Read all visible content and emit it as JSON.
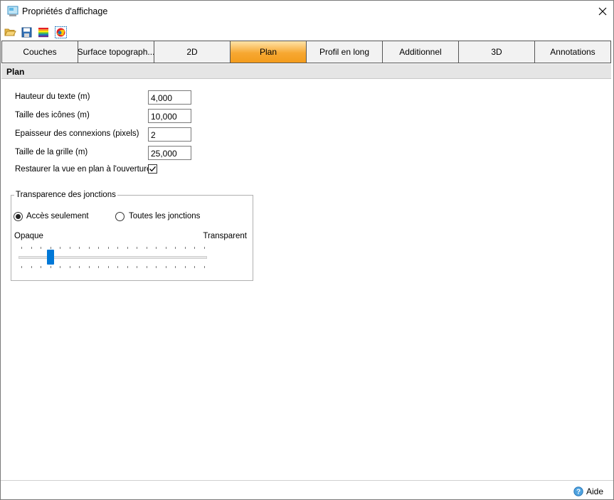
{
  "window": {
    "title": "Propriétés d'affichage"
  },
  "toolbar": {
    "icons": [
      "open-folder-icon",
      "save-icon",
      "rainbow-palette-icon",
      "color-picker-icon"
    ]
  },
  "tabs": [
    {
      "label": "Couches",
      "active": false
    },
    {
      "label": "Surface topograph...",
      "active": false
    },
    {
      "label": "2D",
      "active": false
    },
    {
      "label": "Plan",
      "active": true
    },
    {
      "label": "Profil en long",
      "active": false
    },
    {
      "label": "Additionnel",
      "active": false
    },
    {
      "label": "3D",
      "active": false
    },
    {
      "label": "Annotations",
      "active": false
    }
  ],
  "section": {
    "title": "Plan"
  },
  "fields": [
    {
      "label": "Hauteur du texte (m)",
      "value": "4,000"
    },
    {
      "label": "Taille des icônes (m)",
      "value": "10,000"
    },
    {
      "label": "Epaisseur des connexions (pixels)",
      "value": "2"
    },
    {
      "label": "Taille de la grille (m)",
      "value": "25,000"
    }
  ],
  "restore_view": {
    "label": "Restaurer la vue en plan à l'ouverture",
    "checked": true
  },
  "transparency": {
    "legend": "Transparence des jonctions",
    "radio_access": {
      "label": "Accès seulement",
      "checked": true
    },
    "radio_all": {
      "label": "Toutes les jonctions",
      "checked": false
    },
    "label_min": "Opaque",
    "label_max": "Transparent",
    "slider_value": 3,
    "slider_max": 19
  },
  "footer": {
    "help_label": "Aide"
  },
  "colors": {
    "active_tab": "#f7a832",
    "slider_thumb": "#0078d7",
    "header_bg": "#e5e5e5"
  }
}
